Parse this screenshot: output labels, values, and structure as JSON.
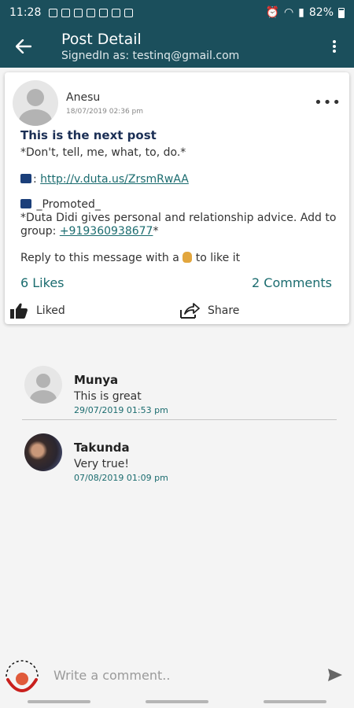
{
  "status_bar": {
    "time": "11:28",
    "battery": "82%"
  },
  "app_bar": {
    "title": "Post Detail",
    "subtitle": "SignedIn as: testinq@gmail.com"
  },
  "post": {
    "author": "Anesu",
    "timestamp": "18/07/2019 02:36 pm",
    "title": "This is the next post",
    "line1": "*Don't, tell, me, what, to, do.*",
    "link_prefix": ": ",
    "link": "http://v.duta.us/ZrsmRwAA",
    "promo_line1": " _Promoted_",
    "promo_line2": "*Duta Didi gives personal and relationship advice. Add to group: ",
    "promo_phone": "+919360938677",
    "promo_suffix": "*",
    "reply_prefix": "Reply to this message with a ",
    "reply_suffix": " to like it",
    "likes": "6 Likes",
    "comments": "2 Comments",
    "like_label": "Liked",
    "share_label": "Share"
  },
  "comments": [
    {
      "name": "Munya",
      "text": "This is great",
      "time": "29/07/2019 01:53 pm"
    },
    {
      "name": "Takunda",
      "text": "Very true!",
      "time": "07/08/2019 01:09 pm"
    }
  ],
  "composer": {
    "placeholder": "Write a comment.."
  },
  "colors": {
    "app_bar": "#1b4f5c",
    "accent": "#1b6c6f",
    "title": "#1b2f55"
  }
}
